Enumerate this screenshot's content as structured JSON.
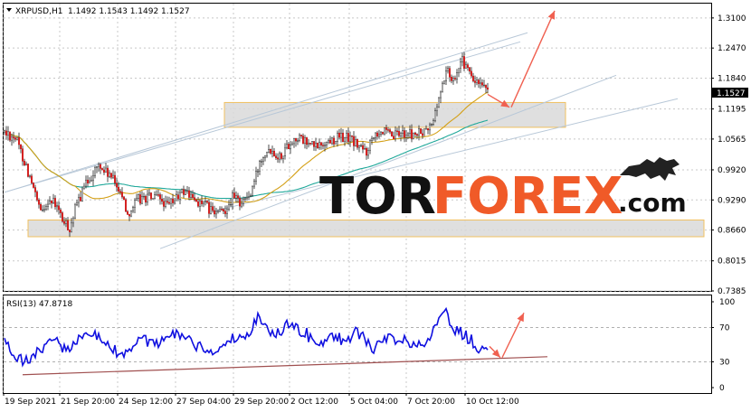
{
  "chart_data": [
    {
      "type": "candlestick",
      "symbol_header": "XRPUSD,H1",
      "ohlc_header": "1.1492 1.1543 1.1492 1.1527",
      "current_price_label": "1.1527",
      "ylim": [
        0.7385,
        1.34
      ],
      "y_ticks": [
        "1.3100",
        "1.2470",
        "1.1840",
        "1.1195",
        "1.0565",
        "0.9920",
        "0.9290",
        "0.8660",
        "0.8015",
        "0.7385"
      ],
      "x_ticks": [
        "19 Sep 2021",
        "21 Sep 20:00",
        "24 Sep 12:00",
        "27 Sep 04:00",
        "29 Sep 20:00",
        "2 Oct 12:00",
        "5 Oct 04:00",
        "7 Oct 20:00",
        "10 Oct 12:00"
      ],
      "price_anchors": [
        [
          0,
          1.07
        ],
        [
          6,
          1.06
        ],
        [
          12,
          1.0
        ],
        [
          16,
          0.95
        ],
        [
          20,
          0.9
        ],
        [
          24,
          0.93
        ],
        [
          28,
          0.92
        ],
        [
          33,
          0.88
        ],
        [
          36,
          0.87
        ],
        [
          40,
          0.92
        ],
        [
          46,
          0.97
        ],
        [
          52,
          1.0
        ],
        [
          58,
          0.98
        ],
        [
          64,
          0.95
        ],
        [
          68,
          0.9
        ],
        [
          74,
          0.93
        ],
        [
          80,
          0.935
        ],
        [
          86,
          0.93
        ],
        [
          90,
          0.915
        ],
        [
          94,
          0.93
        ],
        [
          100,
          0.95
        ],
        [
          104,
          0.93
        ],
        [
          110,
          0.92
        ],
        [
          116,
          0.9
        ],
        [
          121,
          0.905
        ],
        [
          126,
          0.935
        ],
        [
          130,
          0.925
        ],
        [
          136,
          0.94
        ],
        [
          142,
          1.02
        ],
        [
          146,
          1.04
        ],
        [
          152,
          1.02
        ],
        [
          158,
          1.05
        ],
        [
          162,
          1.06
        ],
        [
          166,
          1.05
        ],
        [
          172,
          1.04
        ],
        [
          178,
          1.05
        ],
        [
          184,
          1.06
        ],
        [
          190,
          1.06
        ],
        [
          196,
          1.04
        ],
        [
          200,
          1.03
        ],
        [
          204,
          1.07
        ],
        [
          208,
          1.075
        ],
        [
          214,
          1.06
        ],
        [
          220,
          1.07
        ],
        [
          226,
          1.065
        ],
        [
          232,
          1.07
        ],
        [
          236,
          1.085
        ],
        [
          240,
          1.14
        ],
        [
          244,
          1.2
        ],
        [
          248,
          1.18
        ],
        [
          252,
          1.225
        ],
        [
          256,
          1.2
        ],
        [
          260,
          1.175
        ],
        [
          264,
          1.165
        ],
        [
          267,
          1.15
        ]
      ],
      "moving_averages": [
        {
          "color": "#1fa89a",
          "period": 100
        },
        {
          "color": "#d4a017",
          "period": 40
        }
      ],
      "support_zones": [
        [
          1.081,
          1.133
        ],
        [
          0.852,
          0.887
        ]
      ],
      "channel_lines": [
        {
          "from": [
            0,
            0.945
          ],
          "to": [
            289,
            1.279
          ],
          "color": "#b8c8d8"
        },
        {
          "from": [
            0,
            0.945
          ],
          "to": [
            285,
            1.26
          ],
          "color": "#b8c8d8"
        },
        {
          "from": [
            86,
            0.827
          ],
          "to": [
            338,
            1.19
          ],
          "color": "#b8c8d8"
        },
        {
          "from": [
            115,
            0.905
          ],
          "to": [
            372,
            1.141
          ],
          "color": "#b8c8d8"
        }
      ],
      "forecast_arrows": [
        {
          "from": [
            267,
            1.15
          ],
          "to": [
            279,
            1.123
          ],
          "color": "#f06050"
        },
        {
          "from": [
            280,
            1.123
          ],
          "to": [
            304,
            1.325
          ],
          "color": "#f06050"
        }
      ]
    },
    {
      "type": "line",
      "indicator_label": "RSI(13) 47.8718",
      "ylim": [
        0,
        100
      ],
      "y_ticks": [
        "100",
        "70",
        "30",
        "0"
      ],
      "rsi_anchors": [
        [
          0,
          55
        ],
        [
          5,
          40
        ],
        [
          10,
          30
        ],
        [
          16,
          35
        ],
        [
          22,
          50
        ],
        [
          28,
          55
        ],
        [
          32,
          45
        ],
        [
          36,
          40
        ],
        [
          42,
          60
        ],
        [
          48,
          65
        ],
        [
          54,
          55
        ],
        [
          60,
          45
        ],
        [
          66,
          35
        ],
        [
          72,
          50
        ],
        [
          78,
          55
        ],
        [
          84,
          50
        ],
        [
          90,
          55
        ],
        [
          96,
          65
        ],
        [
          100,
          55
        ],
        [
          106,
          50
        ],
        [
          112,
          40
        ],
        [
          118,
          45
        ],
        [
          124,
          55
        ],
        [
          130,
          60
        ],
        [
          136,
          65
        ],
        [
          140,
          80
        ],
        [
          146,
          70
        ],
        [
          150,
          60
        ],
        [
          156,
          75
        ],
        [
          160,
          70
        ],
        [
          166,
          65
        ],
        [
          172,
          50
        ],
        [
          176,
          55
        ],
        [
          182,
          60
        ],
        [
          188,
          55
        ],
        [
          194,
          65
        ],
        [
          200,
          55
        ],
        [
          204,
          40
        ],
        [
          208,
          55
        ],
        [
          212,
          60
        ],
        [
          216,
          50
        ],
        [
          222,
          55
        ],
        [
          228,
          50
        ],
        [
          234,
          55
        ],
        [
          238,
          70
        ],
        [
          244,
          85
        ],
        [
          248,
          70
        ],
        [
          252,
          65
        ],
        [
          258,
          55
        ],
        [
          262,
          45
        ],
        [
          267,
          48
        ]
      ],
      "trend_line": {
        "from": [
          10,
          15
        ],
        "to": [
          300,
          36
        ],
        "color": "#a05050"
      },
      "forecast_arrows": [
        {
          "from": [
            268,
            48
          ],
          "to": [
            274,
            35
          ],
          "color": "#f06050"
        },
        {
          "from": [
            275,
            35
          ],
          "to": [
            287,
            87
          ],
          "color": "#f06050"
        }
      ]
    }
  ],
  "brand": {
    "part1": "TOR",
    "part2": "FOREX",
    "part3": ".com",
    "accent_color": "#f05a28"
  }
}
